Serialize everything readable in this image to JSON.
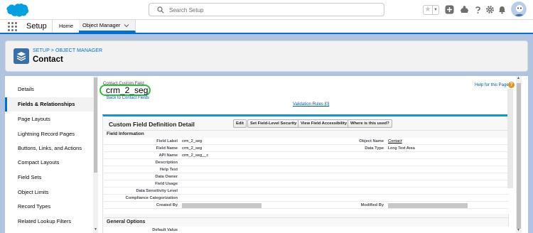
{
  "header": {
    "search_placeholder": "Search Setup"
  },
  "nav": {
    "app_name": "Setup",
    "home_tab": "Home",
    "object_manager_tab": "Object Manager"
  },
  "page_header": {
    "breadcrumb": "SETUP > OBJECT MANAGER",
    "title": "Contact"
  },
  "sidebar": {
    "items": [
      {
        "label": "Details"
      },
      {
        "label": "Fields & Relationships"
      },
      {
        "label": "Page Layouts"
      },
      {
        "label": "Lightning Record Pages"
      },
      {
        "label": "Buttons, Links, and Actions"
      },
      {
        "label": "Compact Layouts"
      },
      {
        "label": "Field Sets"
      },
      {
        "label": "Object Limits"
      },
      {
        "label": "Record Types"
      },
      {
        "label": "Related Lookup Filters"
      }
    ],
    "active_index": 1
  },
  "content": {
    "caption": "Contact Custom Field",
    "field_title": "crm_2_seg",
    "back_link": "Back to Contact Fields",
    "help_link": "Help for this Page",
    "validation_rules": "Validation Rules [0]",
    "section_title": "Custom Field Definition Detail",
    "buttons": {
      "edit": "Edit",
      "set_fls": "Set Field-Level Security",
      "view_accessibility": "View Field Accessibility",
      "where_used": "Where is this used?"
    },
    "field_info_header": "Field Information",
    "general_options_header": "General Options",
    "rows": [
      {
        "label": "Field Label",
        "value": "crm_2_seg",
        "label2": "Object Name",
        "value2": "Contact"
      },
      {
        "label": "Field Name",
        "value": "crm_2_seg",
        "label2": "Data Type",
        "value2": "Long Text Area"
      },
      {
        "label": "API Name",
        "value": "crm_2_seg__c",
        "label2": "",
        "value2": ""
      },
      {
        "label": "Description",
        "value": "",
        "label2": "",
        "value2": ""
      },
      {
        "label": "Help Text",
        "value": "",
        "label2": "",
        "value2": ""
      },
      {
        "label": "Data Owner",
        "value": "",
        "label2": "",
        "value2": ""
      },
      {
        "label": "Field Usage",
        "value": "",
        "label2": "",
        "value2": ""
      },
      {
        "label": "Data Sensitivity Level",
        "value": "",
        "label2": "",
        "value2": ""
      },
      {
        "label": "Compliance Categorization",
        "value": "",
        "label2": "",
        "value2": ""
      },
      {
        "label": "Created By",
        "value": "",
        "label2": "Modified By",
        "value2": ""
      }
    ],
    "default_value_label": "Default Value"
  },
  "colors": {
    "brand_blue": "#0070d2",
    "section_accent": "#1797c0",
    "highlight_circle": "#27c241",
    "help_orange": "#e39321"
  }
}
